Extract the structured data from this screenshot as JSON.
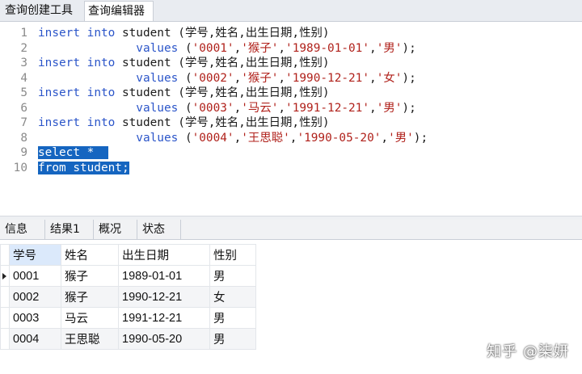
{
  "top_tabs": [
    "查询创建工具",
    "查询编辑器"
  ],
  "editor": {
    "lines": [
      {
        "n": "1",
        "parts": [
          [
            "kw",
            "insert"
          ],
          [
            "t",
            " "
          ],
          [
            "kw",
            "into"
          ],
          [
            "t",
            " student (学号,姓名,出生日期,性别)"
          ]
        ]
      },
      {
        "n": "2",
        "parts": [
          [
            "t",
            "              "
          ],
          [
            "kw",
            "values"
          ],
          [
            "t",
            " ("
          ],
          [
            "str",
            "'0001'"
          ],
          [
            "t",
            ","
          ],
          [
            "str",
            "'猴子'"
          ],
          [
            "t",
            ","
          ],
          [
            "str",
            "'1989-01-01'"
          ],
          [
            "t",
            ","
          ],
          [
            "str",
            "'男'"
          ],
          [
            "t",
            ");"
          ]
        ]
      },
      {
        "n": "3",
        "parts": [
          [
            "kw",
            "insert"
          ],
          [
            "t",
            " "
          ],
          [
            "kw",
            "into"
          ],
          [
            "t",
            " student (学号,姓名,出生日期,性别)"
          ]
        ]
      },
      {
        "n": "4",
        "parts": [
          [
            "t",
            "              "
          ],
          [
            "kw",
            "values"
          ],
          [
            "t",
            " ("
          ],
          [
            "str",
            "'0002'"
          ],
          [
            "t",
            ","
          ],
          [
            "str",
            "'猴子'"
          ],
          [
            "t",
            ","
          ],
          [
            "str",
            "'1990-12-21'"
          ],
          [
            "t",
            ","
          ],
          [
            "str",
            "'女'"
          ],
          [
            "t",
            ");"
          ]
        ]
      },
      {
        "n": "5",
        "parts": [
          [
            "kw",
            "insert"
          ],
          [
            "t",
            " "
          ],
          [
            "kw",
            "into"
          ],
          [
            "t",
            " student (学号,姓名,出生日期,性别)"
          ]
        ]
      },
      {
        "n": "6",
        "parts": [
          [
            "t",
            "              "
          ],
          [
            "kw",
            "values"
          ],
          [
            "t",
            " ("
          ],
          [
            "str",
            "'0003'"
          ],
          [
            "t",
            ","
          ],
          [
            "str",
            "'马云'"
          ],
          [
            "t",
            ","
          ],
          [
            "str",
            "'1991-12-21'"
          ],
          [
            "t",
            ","
          ],
          [
            "str",
            "'男'"
          ],
          [
            "t",
            ");"
          ]
        ]
      },
      {
        "n": "7",
        "parts": [
          [
            "kw",
            "insert"
          ],
          [
            "t",
            " "
          ],
          [
            "kw",
            "into"
          ],
          [
            "t",
            " student (学号,姓名,出生日期,性别)"
          ]
        ]
      },
      {
        "n": "8",
        "parts": [
          [
            "t",
            "              "
          ],
          [
            "kw",
            "values"
          ],
          [
            "t",
            " ("
          ],
          [
            "str",
            "'0004'"
          ],
          [
            "t",
            ","
          ],
          [
            "str",
            "'王思聪'"
          ],
          [
            "t",
            ","
          ],
          [
            "str",
            "'1990-05-20'"
          ],
          [
            "t",
            ","
          ],
          [
            "str",
            "'男'"
          ],
          [
            "t",
            ");"
          ]
        ]
      },
      {
        "n": "9",
        "parts": [
          [
            "sel",
            "select *  "
          ]
        ]
      },
      {
        "n": "10",
        "parts": [
          [
            "sel",
            "from student;"
          ]
        ]
      }
    ]
  },
  "result_tabs": [
    "信息",
    "结果1",
    "概况",
    "状态"
  ],
  "active_result_tab": 1,
  "grid": {
    "columns": [
      "学号",
      "姓名",
      "出生日期",
      "性别"
    ],
    "rows": [
      [
        "0001",
        "猴子",
        "1989-01-01",
        "男"
      ],
      [
        "0002",
        "猴子",
        "1990-12-21",
        "女"
      ],
      [
        "0003",
        "马云",
        "1991-12-21",
        "男"
      ],
      [
        "0004",
        "王思聪",
        "1990-05-20",
        "男"
      ]
    ]
  },
  "watermark": "知乎 @柒妍"
}
